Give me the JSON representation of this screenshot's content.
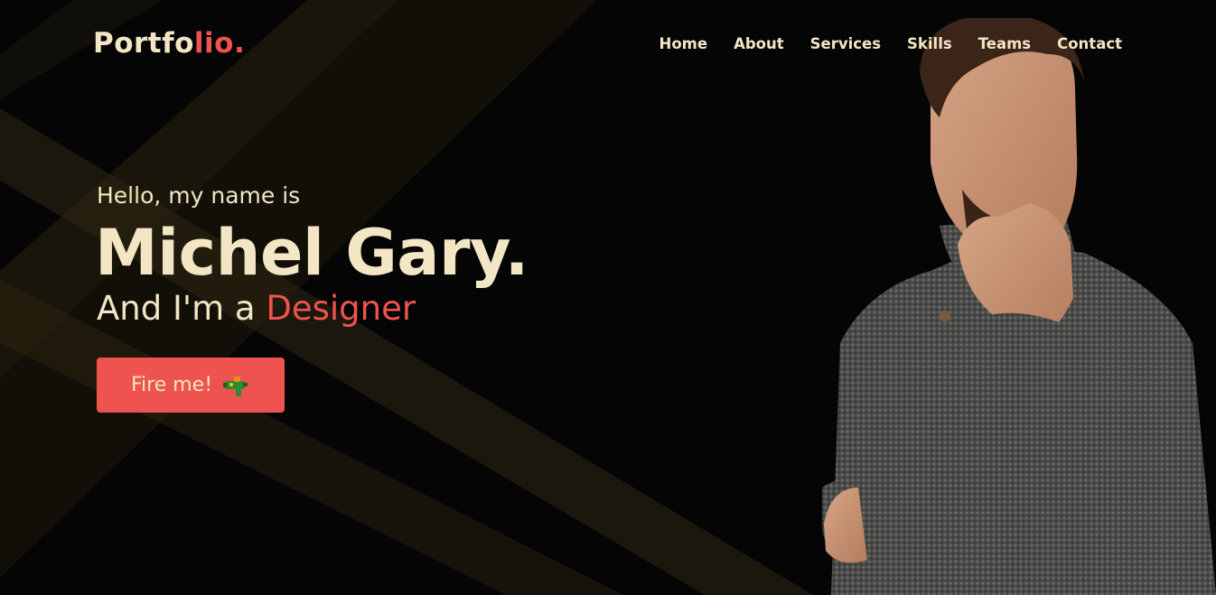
{
  "navbar": {
    "logo_main": "Portfo",
    "logo_accent": "lio.",
    "links": [
      {
        "label": "Home"
      },
      {
        "label": "About"
      },
      {
        "label": "Services"
      },
      {
        "label": "Skills"
      },
      {
        "label": "Teams"
      },
      {
        "label": "Contact"
      }
    ]
  },
  "hero": {
    "greeting": "Hello, my name is",
    "name": "Michel Gary.",
    "role_prefix": "And I'm a ",
    "role": "Designer",
    "cta_label": "Fire me!",
    "cta_icon": "water-pistol-icon",
    "portrait_icon": "portrait-photo"
  },
  "colors": {
    "background": "#050505",
    "text": "#f3e6c4",
    "accent": "#ef5350",
    "ray": "#3a2f12"
  }
}
